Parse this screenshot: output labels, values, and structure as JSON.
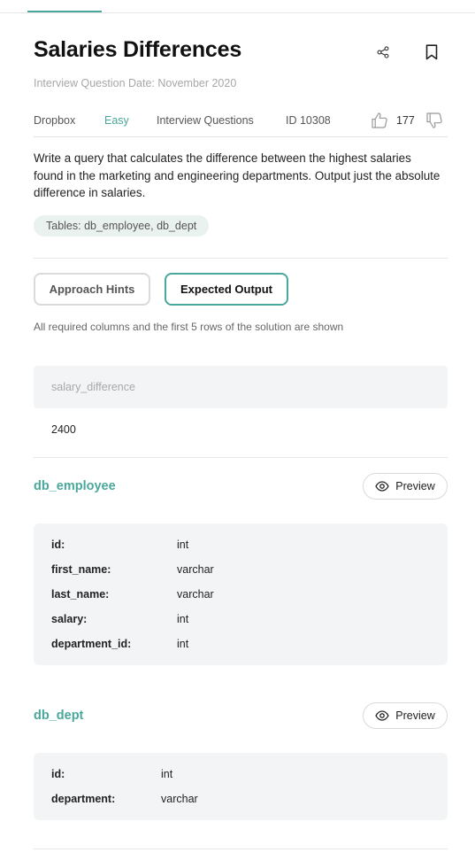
{
  "question": {
    "title": "Salaries Differences",
    "date": "Interview Question Date: November 2020",
    "company": "Dropbox",
    "difficulty": "Easy",
    "type": "Interview Questions",
    "id": "ID 10308",
    "votes": "177",
    "text": "Write a query that calculates the difference between the highest salaries found in the marketing and engineering departments. Output just the absolute difference in salaries.",
    "tables": "Tables: db_employee, db_dept"
  },
  "tabs": {
    "hints": "Approach Hints",
    "output": "Expected Output"
  },
  "output": {
    "caption": "All required columns and the first 5 rows of the solution are shown",
    "columns": [
      "salary_difference"
    ],
    "rows": [
      [
        "2400"
      ]
    ]
  },
  "schemas": [
    {
      "name": "db_employee",
      "preview": "Preview",
      "columns": [
        {
          "name": "id:",
          "type": "int"
        },
        {
          "name": "first_name:",
          "type": "varchar"
        },
        {
          "name": "last_name:",
          "type": "varchar"
        },
        {
          "name": "salary:",
          "type": "int"
        },
        {
          "name": "department_id:",
          "type": "int"
        }
      ]
    },
    {
      "name": "db_dept",
      "preview": "Preview",
      "columns": [
        {
          "name": "id:",
          "type": "int"
        },
        {
          "name": "department:",
          "type": "varchar"
        }
      ]
    }
  ],
  "icons": {
    "share": "share-icon",
    "bookmark": "bookmark-icon",
    "thumbs_up": "thumbs-up-icon",
    "thumbs_down": "thumbs-down-icon",
    "eye": "eye-icon"
  },
  "colors": {
    "accent": "#4aa79b",
    "pill_bg": "#eaf2ef",
    "table_bg": "#f2f4f5"
  }
}
